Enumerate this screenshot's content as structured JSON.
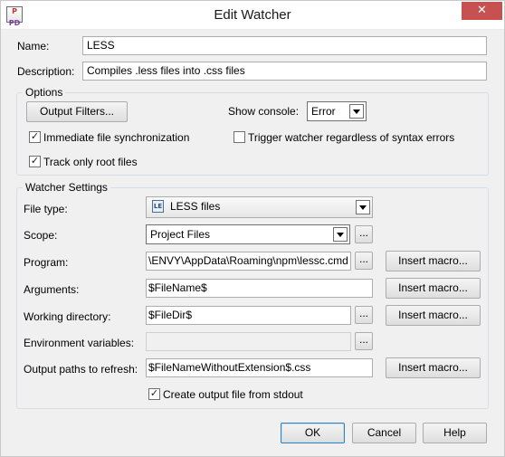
{
  "window": {
    "title": "Edit Watcher",
    "app_icon": "phpstorm-logo-icon",
    "app_icon_text_top": "P",
    "app_icon_text_bottom": "PD",
    "close_glyph": "✕"
  },
  "name": {
    "label": "Name:",
    "value": "LESS"
  },
  "description": {
    "label": "Description:",
    "value": "Compiles .less files into .css files"
  },
  "options": {
    "title": "Options",
    "output_filters_label": "Output Filters...",
    "show_console_label": "Show console:",
    "show_console_value": "Error",
    "immediate_sync": {
      "label": "Immediate file synchronization",
      "checked": true
    },
    "trigger_regardless": {
      "label": "Trigger watcher regardless of syntax errors",
      "checked": false
    },
    "track_root": {
      "label": "Track only root files",
      "checked": true
    }
  },
  "watcher_settings": {
    "title": "Watcher Settings",
    "file_type_label": "File type:",
    "file_type_value": "LESS files",
    "file_type_icon_text": "LE",
    "scope_label": "Scope:",
    "scope_value": "Project Files",
    "program_label": "Program:",
    "program_value": "\\ENVY\\AppData\\Roaming\\npm\\lessc.cmd",
    "arguments_label": "Arguments:",
    "arguments_value": "$FileName$",
    "working_dir_label": "Working directory:",
    "working_dir_value": "$FileDir$",
    "env_vars_label": "Environment variables:",
    "env_vars_value": "",
    "output_paths_label": "Output paths to refresh:",
    "output_paths_value": "$FileNameWithoutExtension$.css",
    "create_output": {
      "label": "Create output file from stdout",
      "checked": true
    },
    "insert_macro_label": "Insert macro...",
    "browse_label": "..."
  },
  "footer": {
    "ok_label": "OK",
    "cancel_label": "Cancel",
    "help_label": "Help"
  },
  "check_glyph": "✓"
}
